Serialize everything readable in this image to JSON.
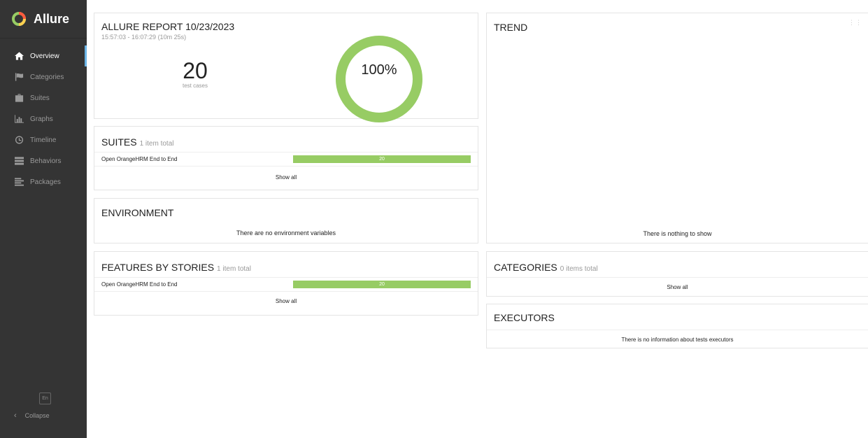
{
  "app": {
    "name": "Allure"
  },
  "sidebar": {
    "items": [
      {
        "label": "Overview",
        "icon": "home-icon",
        "active": true
      },
      {
        "label": "Categories",
        "icon": "flag-icon"
      },
      {
        "label": "Suites",
        "icon": "briefcase-icon"
      },
      {
        "label": "Graphs",
        "icon": "bar-chart-icon"
      },
      {
        "label": "Timeline",
        "icon": "clock-icon"
      },
      {
        "label": "Behaviors",
        "icon": "list-icon"
      },
      {
        "label": "Packages",
        "icon": "align-left-icon"
      }
    ],
    "language": "En",
    "collapse": "Collapse"
  },
  "summary": {
    "title": "ALLURE REPORT 10/23/2023",
    "time": "15:57:03 - 16:07:29 (10m 25s)",
    "count": "20",
    "count_label": "test cases",
    "percent": "100%",
    "pass_fraction": 1.0,
    "pass_color": "#97cc64"
  },
  "suites": {
    "title": "SUITES",
    "subtitle": "1 item total",
    "rows": [
      {
        "name": "Open OrangeHRM End to End",
        "value": "20"
      }
    ],
    "show_all": "Show all"
  },
  "environment": {
    "title": "ENVIRONMENT",
    "message": "There are no environment variables"
  },
  "features": {
    "title": "FEATURES BY STORIES",
    "subtitle": "1 item total",
    "rows": [
      {
        "name": "Open OrangeHRM End to End",
        "value": "20"
      }
    ],
    "show_all": "Show all"
  },
  "trend": {
    "title": "TREND",
    "message": "There is nothing to show"
  },
  "categories": {
    "title": "CATEGORIES",
    "subtitle": "0 items total",
    "show_all": "Show all"
  },
  "executors": {
    "title": "EXECUTORS",
    "message": "There is no information about tests executors"
  }
}
